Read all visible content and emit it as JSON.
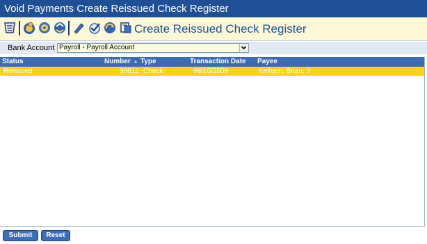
{
  "window": {
    "title": "Void Payments Create Reissued Check Register"
  },
  "toolbar": {
    "title": "Create Reissued Check Register",
    "icons": [
      "list-icon",
      "coin-person-icon",
      "coin-gear-icon",
      "coin-arrows-icon",
      "pencil-icon",
      "check-icon",
      "coin-refresh-icon",
      "register-icon"
    ]
  },
  "bank": {
    "label": "Bank Account",
    "selected": "Payroll - Payroll Account"
  },
  "grid": {
    "columns": [
      "Status",
      "Number",
      "Type",
      "Transaction Date",
      "Payee"
    ],
    "rows": [
      {
        "status": "Reissued",
        "number": "30812",
        "type": "Check",
        "date": "09/10/2009",
        "payee": "Kelham, Brian, J"
      }
    ]
  },
  "buttons": {
    "submit": "Submit",
    "reset": "Reset"
  },
  "colors": {
    "titlebar": "#1f4f94",
    "toolbar_bg": "#fff8d8",
    "header_bg": "#3d6bb3",
    "selected_row": "#ffd21a"
  }
}
